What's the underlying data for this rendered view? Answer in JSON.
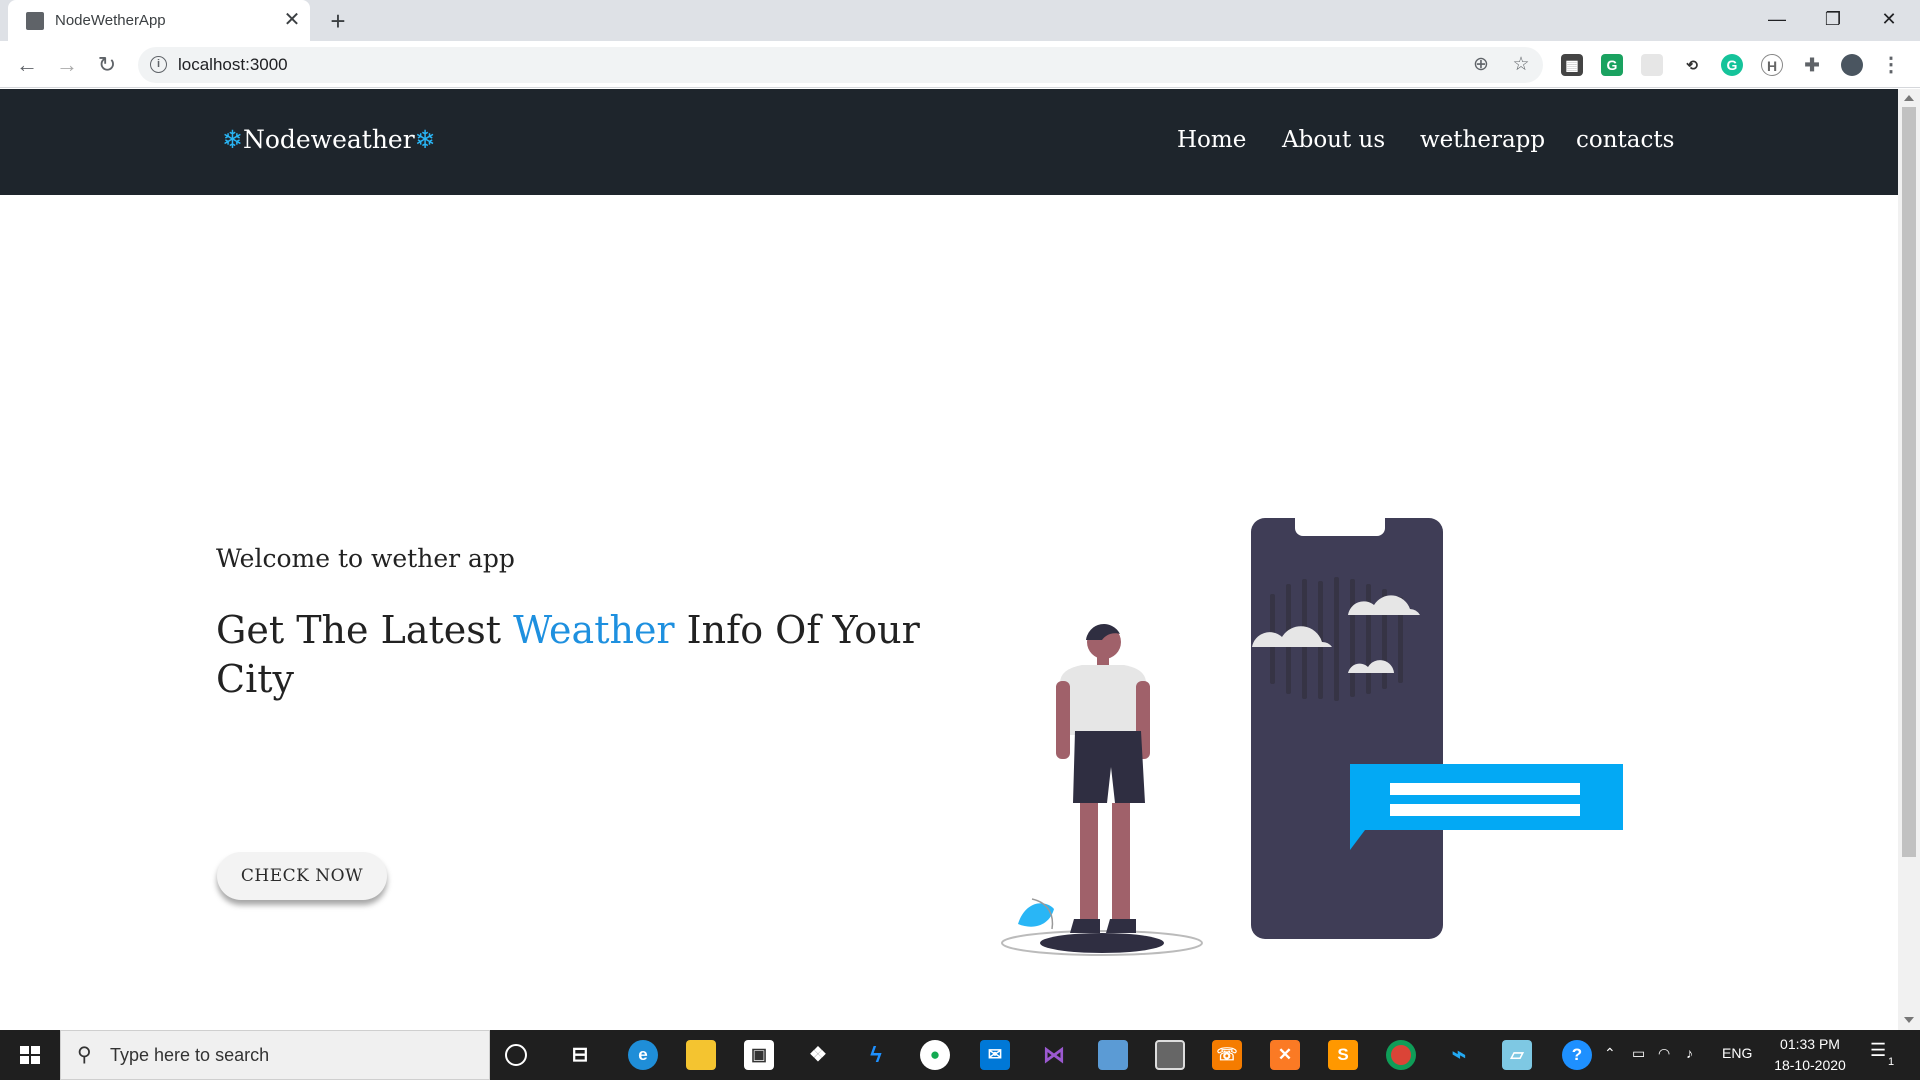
{
  "browser": {
    "tab_title": "NodeWetherApp",
    "tab_close": "✕",
    "new_tab": "+",
    "url": "localhost:3000",
    "window_controls": {
      "minimize": "—",
      "restore": "❐",
      "close": "✕"
    },
    "nav": {
      "back": "←",
      "forward": "→",
      "reload": "↻"
    },
    "omnibox_icons": {
      "zoom": "⊕",
      "bookmark": "☆"
    },
    "menu": "⋮"
  },
  "site": {
    "brand_prefix": "❄",
    "brand": "Nodeweather",
    "brand_suffix": "❄",
    "nav_links": [
      "Home",
      "About us",
      "wetherapp",
      "contacts"
    ]
  },
  "hero": {
    "welcome": "Welcome to wether app",
    "headline_part1": "Get The Latest ",
    "headline_highlight": "Weather",
    "headline_part2": " Info Of Your City",
    "button": "CHECK NOW"
  },
  "taskbar": {
    "search_placeholder": "Type here to search",
    "search_icon": "⚲",
    "language": "ENG",
    "time": "01:33 PM",
    "date": "18-10-2020",
    "notification_count": "1"
  },
  "colors": {
    "navbar_bg": "#1e252c",
    "accent": "#1e90df",
    "phone": "#3f3d56",
    "chat_bubble": "#03a9f4"
  }
}
